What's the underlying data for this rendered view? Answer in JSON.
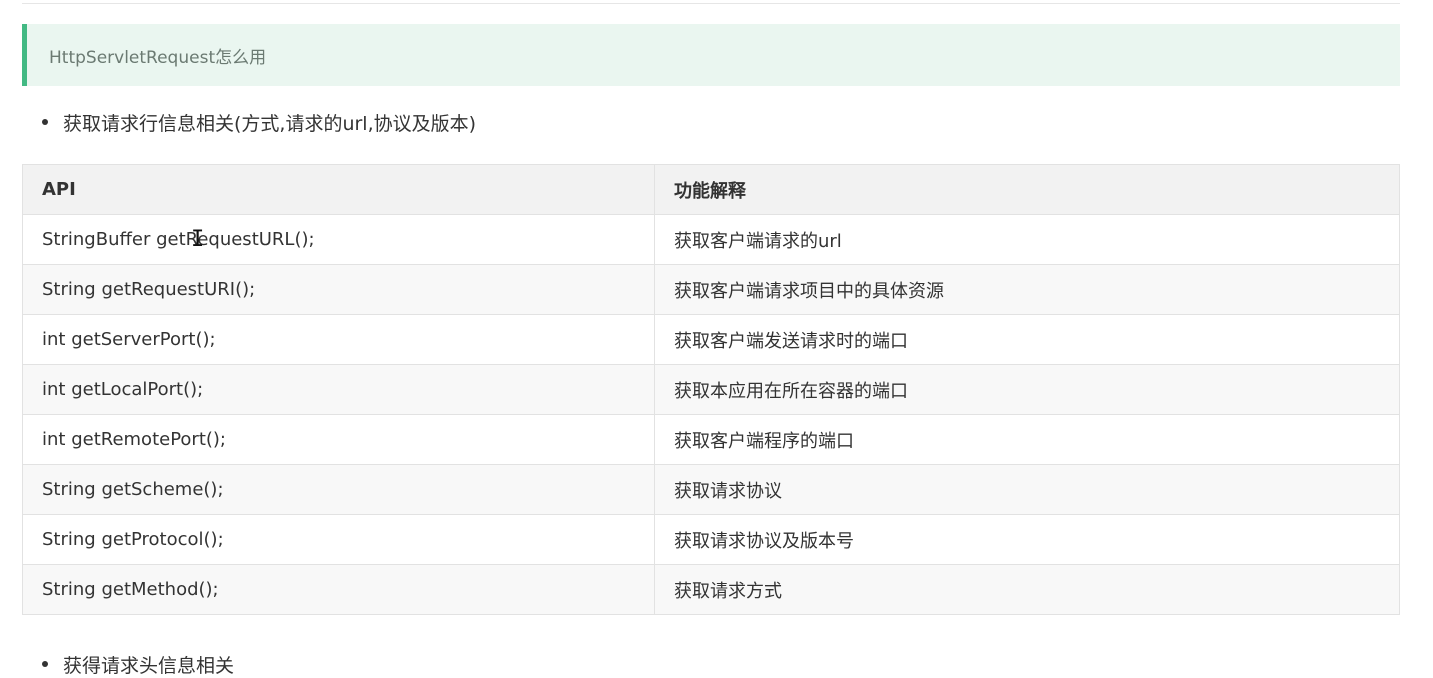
{
  "tip": {
    "text": "HttpServletRequest怎么用"
  },
  "bullets": [
    {
      "text": "获取请求行信息相关(方式,请求的url,协议及版本)"
    },
    {
      "text": "获得请求头信息相关"
    }
  ],
  "table": {
    "headers": [
      "API",
      "功能解释"
    ],
    "rows": [
      [
        "StringBuffer getRequestURL();",
        "获取客户端请求的url"
      ],
      [
        "String getRequestURI();",
        "获取客户端请求项目中的具体资源"
      ],
      [
        "int getServerPort();",
        "获取客户端发送请求时的端口"
      ],
      [
        "int getLocalPort();",
        "获取本应用在所在容器的端口"
      ],
      [
        "int getRemotePort();",
        "获取客户端程序的端口"
      ],
      [
        "String getScheme();",
        "获取请求协议"
      ],
      [
        "String getProtocol();",
        "获取请求协议及版本号"
      ],
      [
        "String getMethod();",
        "获取请求方式"
      ]
    ]
  },
  "colors": {
    "tip_background": "#eaf6f0",
    "tip_accent": "#42b983",
    "header_background": "#f2f2f2",
    "border": "#e2e2e2"
  },
  "icons": {
    "text_cursor": "text-cursor-icon"
  }
}
